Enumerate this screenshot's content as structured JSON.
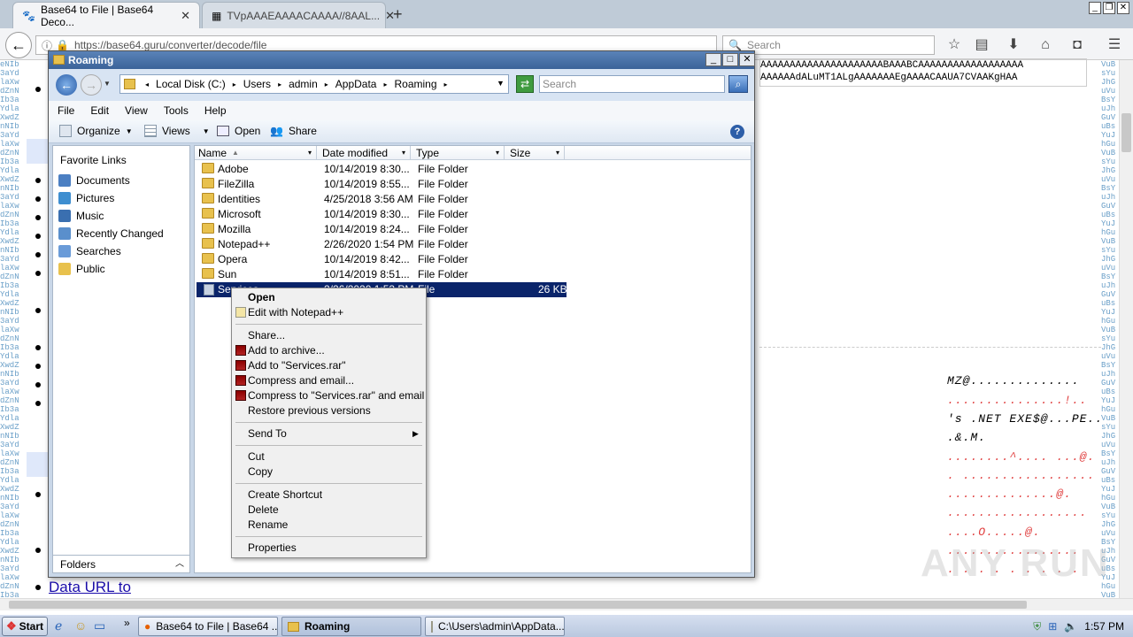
{
  "browser": {
    "tabs": [
      {
        "label": "Base64 to File | Base64 Deco..."
      },
      {
        "label": "TVpAAAEAAAACAAAA//8AAL..."
      }
    ],
    "url": "https://base64.guru/converter/decode/file",
    "search_placeholder": "Search"
  },
  "page": {
    "hex_line1": "AAAAAAAAAAAAAAAAAAAAABAAABCAAAAAAAAAAAAAAAAAA",
    "hex_line2": "AAAAAAdALuMT1ALgAAAAAAAEgAAAACAAUA7CVAAKgHAA",
    "mz_lines": [
      "MZ@..............",
      "...............!..",
      "'s .NET EXE$@...PE..",
      ".&.M.",
      "........^.... ...@.",
      ". .................",
      "..............@.",
      "..................",
      "....O.....@.",
      ".................",
      ". . . . . . . . ."
    ],
    "data_url_link": "Data URL to",
    "watermark": "ANY RUN"
  },
  "explorer": {
    "title": "Roaming",
    "breadcrumb": [
      "Local Disk (C:)",
      "Users",
      "admin",
      "AppData",
      "Roaming"
    ],
    "search_placeholder": "Search",
    "menu": [
      "File",
      "Edit",
      "View",
      "Tools",
      "Help"
    ],
    "toolbar": {
      "organize": "Organize",
      "views": "Views",
      "open": "Open",
      "share": "Share"
    },
    "favorites_header": "Favorite Links",
    "favorites": [
      {
        "label": "Documents",
        "color": "#4b7fc2"
      },
      {
        "label": "Pictures",
        "color": "#3e8ed0"
      },
      {
        "label": "Music",
        "color": "#3a6fb0"
      },
      {
        "label": "Recently Changed",
        "color": "#5a8fcc"
      },
      {
        "label": "Searches",
        "color": "#6a9bd8"
      },
      {
        "label": "Public",
        "color": "#e8c14d"
      }
    ],
    "folders_label": "Folders",
    "columns": {
      "name": "Name",
      "date": "Date modified",
      "type": "Type",
      "size": "Size"
    },
    "files": [
      {
        "name": "Adobe",
        "date": "10/14/2019 8:30...",
        "type": "File Folder",
        "size": ""
      },
      {
        "name": "FileZilla",
        "date": "10/14/2019 8:55...",
        "type": "File Folder",
        "size": ""
      },
      {
        "name": "Identities",
        "date": "4/25/2018 3:56 AM",
        "type": "File Folder",
        "size": ""
      },
      {
        "name": "Microsoft",
        "date": "10/14/2019 8:30...",
        "type": "File Folder",
        "size": ""
      },
      {
        "name": "Mozilla",
        "date": "10/14/2019 8:24...",
        "type": "File Folder",
        "size": ""
      },
      {
        "name": "Notepad++",
        "date": "2/26/2020 1:54 PM",
        "type": "File Folder",
        "size": ""
      },
      {
        "name": "Opera",
        "date": "10/14/2019 8:42...",
        "type": "File Folder",
        "size": ""
      },
      {
        "name": "Sun",
        "date": "10/14/2019 8:51...",
        "type": "File Folder",
        "size": ""
      },
      {
        "name": "Services",
        "date": "2/26/2020 1:53 PM",
        "type": "File",
        "size": "26 KB"
      }
    ]
  },
  "context_menu": {
    "open": "Open",
    "edit_notepad": "Edit with Notepad++",
    "share": "Share...",
    "add_archive": "Add to archive...",
    "add_rar": "Add to \"Services.rar\"",
    "compress_email": "Compress and email...",
    "compress_rar_email": "Compress to \"Services.rar\" and email",
    "restore": "Restore previous versions",
    "send_to": "Send To",
    "cut": "Cut",
    "copy": "Copy",
    "create_shortcut": "Create Shortcut",
    "delete": "Delete",
    "rename": "Rename",
    "properties": "Properties"
  },
  "taskbar": {
    "start": "Start",
    "tasks": [
      {
        "label": "Base64 to File | Base64 ..."
      },
      {
        "label": "Roaming"
      },
      {
        "label": "C:\\Users\\admin\\AppData..."
      }
    ],
    "clock": "1:57 PM"
  }
}
